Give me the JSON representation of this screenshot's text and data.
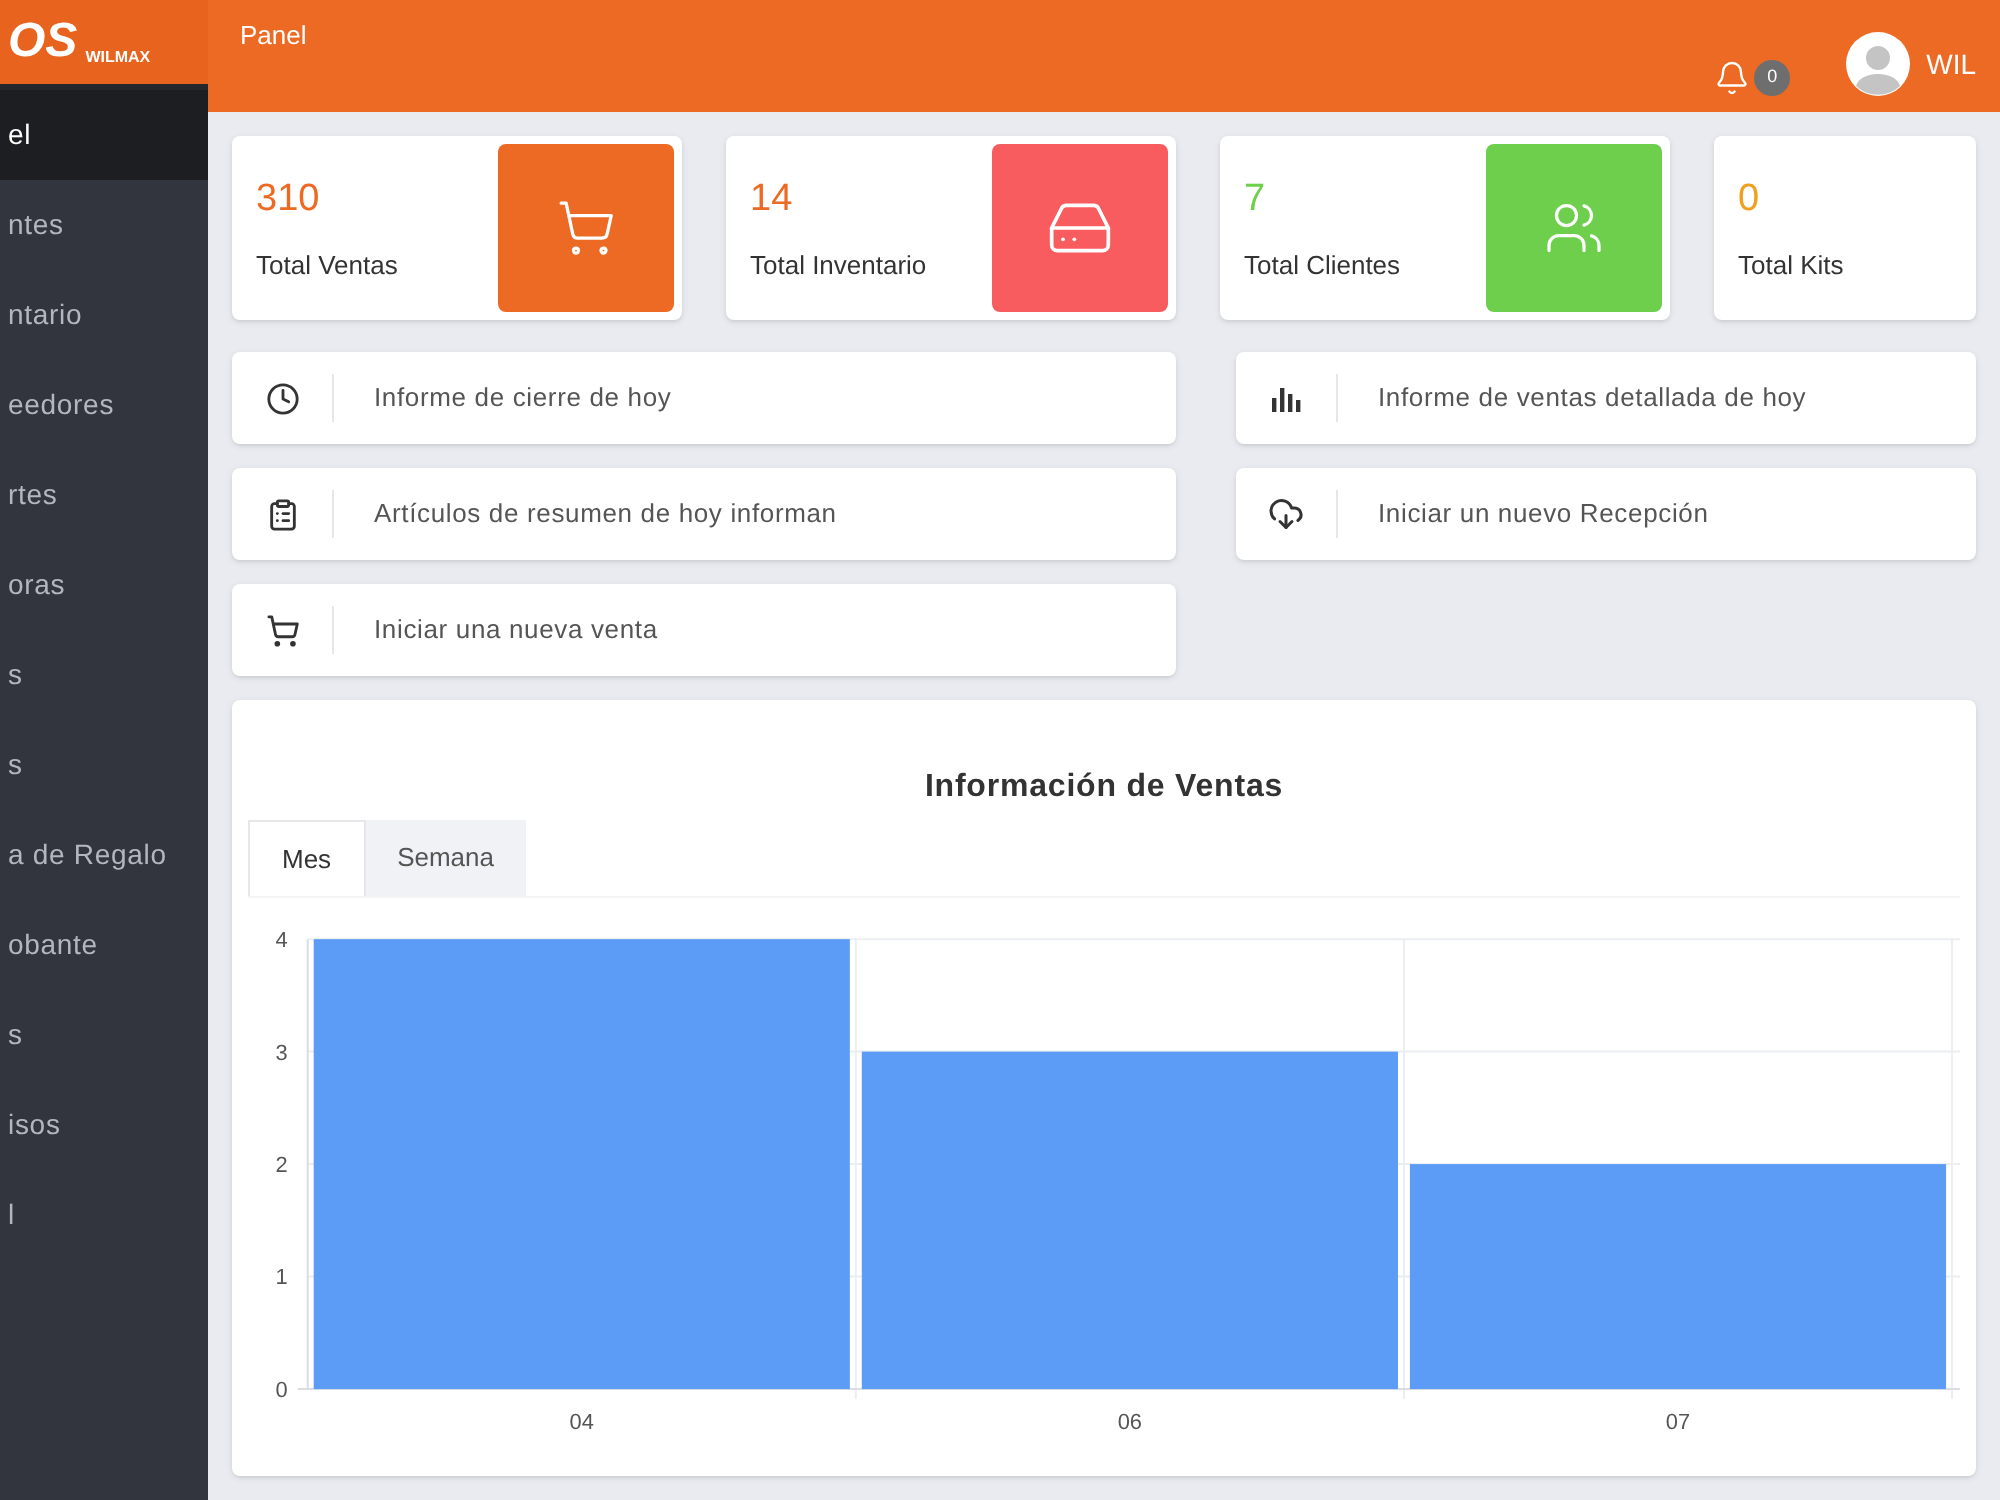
{
  "sidebar": {
    "logo": {
      "text": "OS",
      "subtext": "WILMAX"
    },
    "items": [
      {
        "label": "el",
        "selected": true
      },
      {
        "label": "ntes",
        "selected": false
      },
      {
        "label": "ntario",
        "selected": false
      },
      {
        "label": "eedores",
        "selected": false
      },
      {
        "label": "rtes",
        "selected": false
      },
      {
        "label": "oras",
        "selected": false
      },
      {
        "label": "s",
        "selected": false
      },
      {
        "label": "s",
        "selected": false
      },
      {
        "label": "a de Regalo",
        "selected": false
      },
      {
        "label": "obante",
        "selected": false
      },
      {
        "label": "s",
        "selected": false
      },
      {
        "label": "isos",
        "selected": false
      },
      {
        "label": "l",
        "selected": false
      }
    ]
  },
  "topbar": {
    "title": "Panel",
    "notifications": "0",
    "user": "WIL"
  },
  "stats": [
    {
      "value": "310",
      "label": "Total Ventas",
      "color": "#ec6a23",
      "tile": {
        "color": "#ec6a23"
      }
    },
    {
      "value": "14",
      "label": "Total Inventario",
      "color": "#ec6a23",
      "tile": {
        "color": "#f85c5e"
      }
    },
    {
      "value": "7",
      "label": "Total Clientes",
      "color": "#6dcf4c",
      "tile": {
        "color": "#6dcf4c"
      }
    },
    {
      "value": "0",
      "label": "Total Kits",
      "color": "#f0a01e"
    }
  ],
  "shortcuts_left": [
    {
      "label": "Informe de cierre de hoy"
    },
    {
      "label": "Artículos de resumen de hoy informan"
    },
    {
      "label": "Iniciar una nueva venta"
    }
  ],
  "shortcuts_right": [
    {
      "label": "Informe de ventas detallada de hoy"
    },
    {
      "label": "Iniciar un nuevo Recepción"
    }
  ],
  "sales_panel": {
    "title": "Información de Ventas",
    "tabs": [
      {
        "label": "Mes",
        "selected": true
      },
      {
        "label": "Semana",
        "selected": false
      }
    ],
    "chart_data": {
      "type": "bar",
      "categories": [
        "04",
        "06",
        "07"
      ],
      "series": [
        {
          "color": "#5c9cf7",
          "values": [
            4,
            3,
            2
          ]
        }
      ],
      "ylim": [
        0,
        4
      ],
      "yticks": [
        0,
        1,
        2,
        3,
        4
      ],
      "grid": true
    }
  }
}
